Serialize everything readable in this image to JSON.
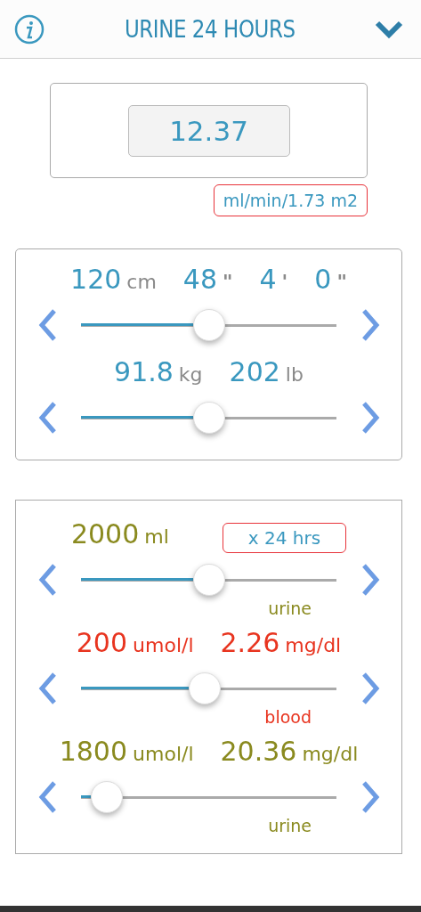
{
  "header": {
    "title": "URINE 24 HOURS"
  },
  "result": {
    "value": "12.37",
    "unit": "ml/min/1.73 m2"
  },
  "panels": [
    {
      "sliders": [
        {
          "color": "#3a98bf",
          "unit_muted": true,
          "level": 0.5,
          "readings": [
            {
              "value": "120",
              "unit": "cm"
            },
            {
              "value": "48",
              "unit": "\""
            },
            {
              "value": "4",
              "unit": "'"
            },
            {
              "value": "0",
              "unit": "\""
            }
          ]
        },
        {
          "color": "#3a98bf",
          "unit_muted": true,
          "level": 0.5,
          "readings": [
            {
              "value": "91.8",
              "unit": "kg"
            },
            {
              "value": "202",
              "unit": "lb"
            }
          ]
        }
      ]
    },
    {
      "sliders": [
        {
          "color": "#8a8a1f",
          "unit_muted": false,
          "level": 0.5,
          "readings": [
            {
              "value": "2000",
              "unit": "ml"
            }
          ],
          "tag": "x 24 hrs",
          "caption": "urine"
        },
        {
          "color": "#e8341f",
          "unit_muted": false,
          "level": 0.485,
          "readings": [
            {
              "value": "200",
              "unit": "umol/l"
            },
            {
              "value": "2.26",
              "unit": "mg/dl"
            }
          ],
          "caption": "blood"
        },
        {
          "color": "#8a8a1f",
          "unit_muted": false,
          "level": 0.1,
          "readings": [
            {
              "value": "1800",
              "unit": "umol/l"
            },
            {
              "value": "20.36",
              "unit": "mg/dl"
            }
          ],
          "caption": "urine"
        }
      ]
    }
  ]
}
